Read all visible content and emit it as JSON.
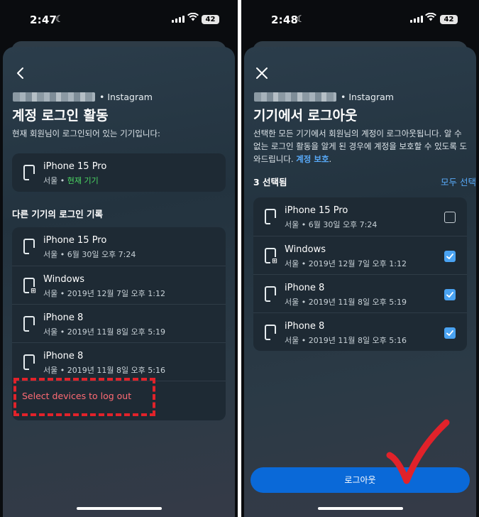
{
  "left": {
    "status": {
      "time": "2:47",
      "battery": "42"
    },
    "account_suffix": "• Instagram",
    "title": "계정 로그인 활동",
    "description": "현재 회원님이 로그인되어 있는 기기입니다:",
    "current_device": {
      "name": "iPhone 15 Pro",
      "location": "서울 • ",
      "tag": "현재 기기",
      "icon": "iphone-icon"
    },
    "other_header": "다른 기기의 로그인 기록",
    "devices": [
      {
        "name": "iPhone 15 Pro",
        "detail": "서울 • 6월 30일 오후 7:24",
        "icon": "iphone-icon"
      },
      {
        "name": "Windows",
        "detail": "서울 • 2019년 12월 7일 오후 1:12",
        "icon": "windows-icon"
      },
      {
        "name": "iPhone 8",
        "detail": "서울 • 2019년 11월 8일 오후 5:19",
        "icon": "iphone-icon"
      },
      {
        "name": "iPhone 8",
        "detail": "서울 • 2019년 11월 8일 오후 5:16",
        "icon": "iphone-icon"
      }
    ],
    "select_link": "Select devices to log out"
  },
  "right": {
    "status": {
      "time": "2:48",
      "battery": "42"
    },
    "account_suffix": "• Instagram",
    "title": "기기에서 로그아웃",
    "description_line1": "선택한 모든 기기에서 회원님의 계정이 로그아웃됩니다. 알 수",
    "description_line2": "없는 로그인 활동을 알게 된 경우에 계정을 보호할 수 있도록 도",
    "description_line3_prefix": "와드립니다. ",
    "description_link": "계정 보호",
    "description_line3_suffix": ".",
    "selected_count": "3 선택됨",
    "select_all": "모두 선택",
    "devices": [
      {
        "name": "iPhone 15 Pro",
        "detail": "서울 • 6월 30일 오후 7:24",
        "checked": false,
        "icon": "iphone-icon"
      },
      {
        "name": "Windows",
        "detail": "서울 • 2019년 12월 7일 오후 1:12",
        "checked": true,
        "icon": "windows-icon"
      },
      {
        "name": "iPhone 8",
        "detail": "서울 • 2019년 11월 8일 오후 5:19",
        "checked": true,
        "icon": "iphone-icon"
      },
      {
        "name": "iPhone 8",
        "detail": "서울 • 2019년 11월 8일 오후 5:16",
        "checked": true,
        "icon": "iphone-icon"
      }
    ],
    "logout_button": "로그아웃"
  },
  "colors": {
    "accent": "#0a69d8",
    "link": "#58a9f7",
    "current_device": "#4cd964",
    "annotation": "#e1222a"
  }
}
